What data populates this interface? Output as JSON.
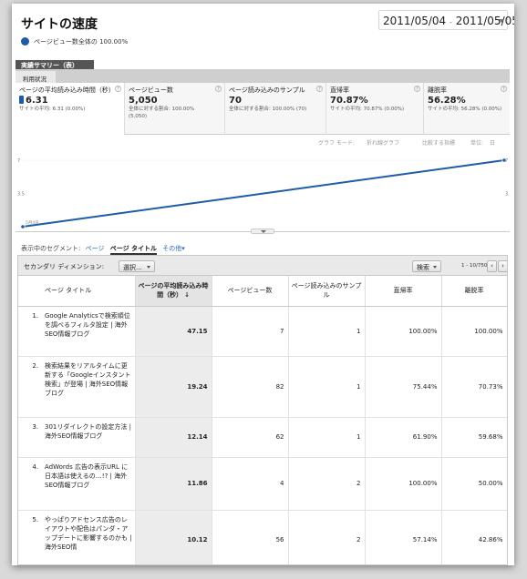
{
  "header": {
    "title": "サイトの速度",
    "date_start": "2011/05/04",
    "date_sep": "-",
    "date_end": "2011/05/05",
    "segment_label": "ページビュー数全体の 100.00%"
  },
  "report_tab": "実績サマリー（表）",
  "overview_tab": "利用状況",
  "scorecards": [
    {
      "label": "ページの平均読み込み時間（秒）",
      "value": "6.31",
      "sub1": "サイトの平均: 6.31 (0.00%)",
      "sub2": ""
    },
    {
      "label": "ページビュー数",
      "value": "5,050",
      "sub1": "全体に対する割合: 100.00%",
      "sub2": "(5,050)"
    },
    {
      "label": "ページ読み込みのサンプル",
      "value": "70",
      "sub1": "全体に対する割合: 100.00% (70)",
      "sub2": ""
    },
    {
      "label": "直帰率",
      "value": "70.87%",
      "sub1": "サイトの平均: 70.87% (0.00%)",
      "sub2": ""
    },
    {
      "label": "離脱率",
      "value": "56.28%",
      "sub1": "サイトの平均: 56.28% (0.00%)",
      "sub2": ""
    }
  ],
  "help_glyph": "?",
  "chart_options": {
    "mode_label": "グラフ モード:",
    "mode_value": "折れ線グラフ",
    "compare": "比較する指標",
    "unit": "単位:",
    "unit_value": "日"
  },
  "chart_data": {
    "type": "line",
    "x": [
      "2011/05/04",
      "2011/05/05"
    ],
    "series": [
      {
        "values": [
          0,
          7
        ]
      }
    ],
    "ylim": [
      0,
      7
    ],
    "y_ticks": [
      "7",
      "3.5"
    ],
    "x_start_label": "5月4日",
    "grid": false,
    "color": "#1c5ca8"
  },
  "segments": {
    "label": "表示中のセグメント:",
    "items": [
      "ページ",
      "ページ タイトル",
      "その他"
    ],
    "active_index": 1
  },
  "toolbar": {
    "secondary_label": "セカンダリ ディメンション:",
    "select_label": "選択...",
    "search_label": "検索",
    "pagination": "1 - 10/750",
    "prev": "‹",
    "next": "›"
  },
  "table": {
    "headers": [
      "ページ タイトル",
      "ページの平均読み込み時間（秒）",
      "ページビュー数",
      "ページ読み込みのサンプル",
      "直帰率",
      "離脱率"
    ],
    "sort_arrow": "↓",
    "rows": [
      {
        "idx": "1.",
        "title": "Google Analyticsで検索順位を調べるフィルタ設定 | 海外SEO情報ブログ",
        "load": "47.15",
        "pv": "7",
        "samples": "1",
        "bounce": "100.00%",
        "exit": "100.00%"
      },
      {
        "idx": "2.",
        "title": "検索結果をリアルタイムに更新する「Googleインスタント検索」が登場 | 海外SEO情報ブログ",
        "load": "19.24",
        "pv": "82",
        "samples": "1",
        "bounce": "75.44%",
        "exit": "70.73%"
      },
      {
        "idx": "3.",
        "title": "301リダイレクトの設定方法 | 海外SEO情報ブログ",
        "load": "12.14",
        "pv": "62",
        "samples": "1",
        "bounce": "61.90%",
        "exit": "59.68%"
      },
      {
        "idx": "4.",
        "title": "AdWords 広告の表示URL に日本語は使えるの…!? | 海外SEO情報ブログ",
        "load": "11.86",
        "pv": "4",
        "samples": "2",
        "bounce": "100.00%",
        "exit": "50.00%"
      },
      {
        "idx": "5.",
        "title": "やっぱりアドセンス広告のレイアウトや配色はパンダ・アップデートに影響するのかも | 海外SEO情",
        "load": "10.12",
        "pv": "56",
        "samples": "2",
        "bounce": "57.14%",
        "exit": "42.86%"
      }
    ]
  }
}
